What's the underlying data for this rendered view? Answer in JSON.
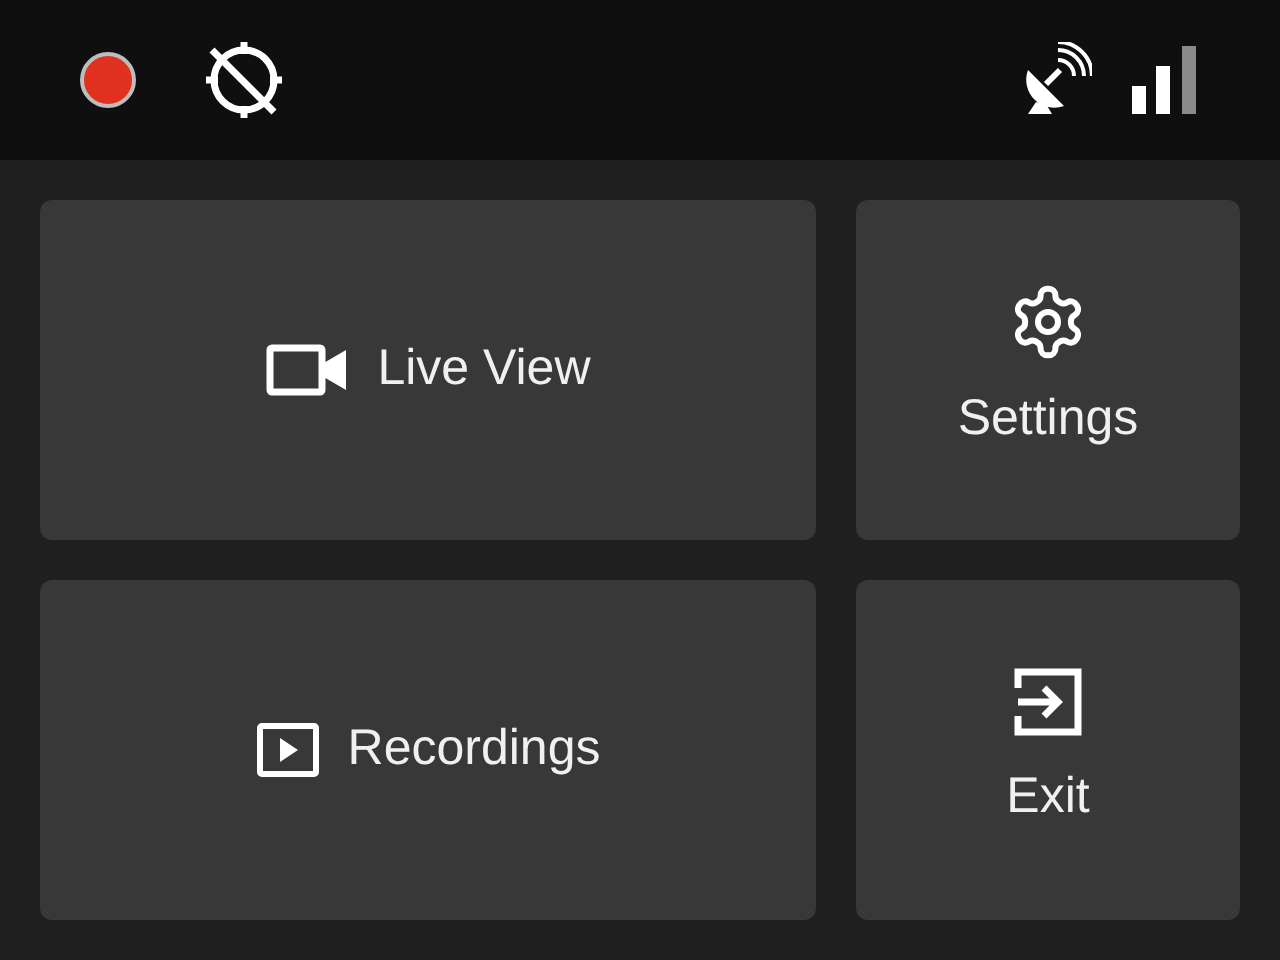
{
  "status_bar": {
    "recording": true,
    "gps_fix": false
  },
  "tiles": [
    {
      "label": "Live View",
      "kind": "row"
    },
    {
      "label": "Settings",
      "kind": "column"
    },
    {
      "label": "Recordings",
      "kind": "row"
    },
    {
      "label": "Exit",
      "kind": "column"
    }
  ]
}
